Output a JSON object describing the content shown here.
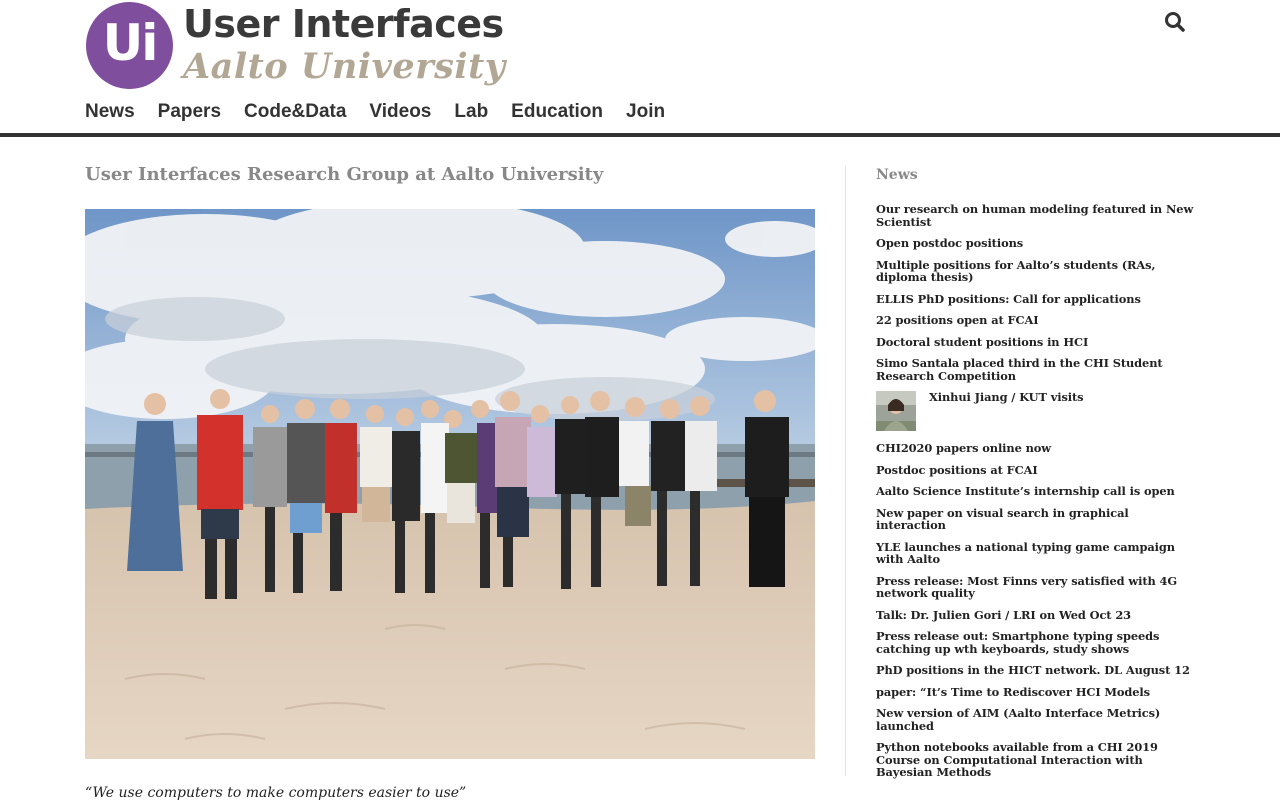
{
  "brand": {
    "logo_mark": "Ui",
    "title": "User Interfaces",
    "subtitle": "Aalto University",
    "mark_color": "#7f4f9e",
    "subtitle_color": "#b2a794"
  },
  "header": {
    "search_icon": "search-icon"
  },
  "nav": {
    "items": [
      {
        "label": "News"
      },
      {
        "label": "Papers"
      },
      {
        "label": "Code&Data"
      },
      {
        "label": "Videos"
      },
      {
        "label": "Lab"
      },
      {
        "label": "Education"
      },
      {
        "label": "Join"
      }
    ]
  },
  "main": {
    "title": "User Interfaces Research Group at Aalto University",
    "tagline": "“We use computers to make computers easier to use”"
  },
  "sidebar": {
    "title": "News",
    "items": [
      {
        "label": "Our research on human modeling featured in New Scientist"
      },
      {
        "label": "Open postdoc positions"
      },
      {
        "label": "Multiple positions for Aalto’s students (RAs, diploma thesis)"
      },
      {
        "label": "ELLIS PhD positions: Call for applications"
      },
      {
        "label": "22 positions open at FCAI"
      },
      {
        "label": "Doctoral student positions in HCI"
      },
      {
        "label": "Simo Santala placed third in the CHI Student Research Competition"
      },
      {
        "label": "Xinhui Jiang / KUT visits"
      },
      {
        "label": "CHI2020 papers online now"
      },
      {
        "label": "Postdoc positions at FCAI"
      },
      {
        "label": "Aalto Science Institute’s internship call is open"
      },
      {
        "label": "New paper on visual search in graphical interaction"
      },
      {
        "label": "YLE launches a national typing game campaign with Aalto"
      },
      {
        "label": "Press release: Most Finns very satisfied with 4G network quality"
      },
      {
        "label": "Talk: Dr. Julien Gori / LRI on Wed Oct 23"
      },
      {
        "label": "Press release out: Smartphone typing speeds catching up wth keyboards, study shows"
      },
      {
        "label": "PhD positions in the HICT network. DL August 12"
      },
      {
        "label": "paper: “It’s Time to Rediscover HCI Models"
      },
      {
        "label": "New version of AIM (Aalto Interface Metrics) launched"
      },
      {
        "label": "Python notebooks available from a CHI 2019 Course on Computational Interaction with Bayesian Methods"
      }
    ]
  }
}
